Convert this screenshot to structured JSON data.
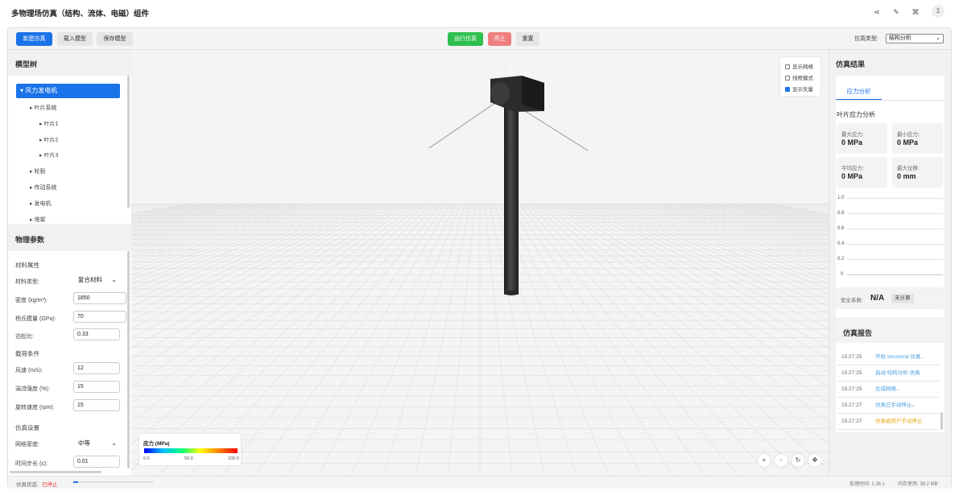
{
  "app": {
    "title": "多物理场仿真（结构、流体、电磁）组件"
  },
  "titlebar_icons": [
    {
      "name": "share-icon",
      "glyph": "⋖"
    },
    {
      "name": "edit-icon",
      "glyph": "✎"
    },
    {
      "name": "apps-icon",
      "glyph": "⌘"
    }
  ],
  "user": {
    "avatar_text": "1"
  },
  "toolbar": {
    "new_sim": "新建仿真",
    "load_model": "载入模型",
    "save_model": "保存模型",
    "run": "运行仿真",
    "stop": "停止",
    "reset": "重置",
    "sim_type_label": "仿真类型:",
    "sim_type_value": "结构分析"
  },
  "model_tree": {
    "title": "模型树",
    "root": "▾ 风力发电机",
    "items": [
      {
        "label": "▸ 叶片系统",
        "level": 1
      },
      {
        "label": "▸ 叶片1",
        "level": 2
      },
      {
        "label": "▸ 叶片2",
        "level": 2
      },
      {
        "label": "▸ 叶片3",
        "level": 2
      },
      {
        "label": "▸ 轮毂",
        "level": 1
      },
      {
        "label": "▸ 传动系统",
        "level": 1
      },
      {
        "label": "▸ 发电机",
        "level": 1
      },
      {
        "label": "▸ 塔架",
        "level": 1
      }
    ]
  },
  "params": {
    "title": "物理参数",
    "material_group": "材料属性",
    "material_type_label": "材料类型:",
    "material_type_value": "复合材料",
    "density_label": "密度 (kg/m³):",
    "density_value": "1850",
    "youngs_label": "杨氏模量 (GPa):",
    "youngs_value": "70",
    "poisson_label": "泊松比:",
    "poisson_value": "0.33",
    "load_group": "载荷条件",
    "wind_label": "风速 (m/s):",
    "wind_value": "12",
    "turb_label": "湍流强度 (%):",
    "turb_value": "15",
    "rot_label": "旋转速度 (rpm):",
    "rot_value": "15",
    "sim_group": "仿真设置",
    "mesh_label": "网格密度:",
    "mesh_value": "中等",
    "step_label": "时间步长 (s):",
    "step_value": "0.01"
  },
  "viewport": {
    "options": [
      {
        "label": "显示网格",
        "checked": false
      },
      {
        "label": "线框模式",
        "checked": false
      },
      {
        "label": "显示矢量",
        "checked": true
      }
    ],
    "legend": {
      "title": "应力 (MPa)",
      "min": "0.0",
      "mid": "50.0",
      "max": "100.0"
    },
    "controls": [
      {
        "name": "zoom-in-icon",
        "glyph": "+"
      },
      {
        "name": "zoom-out-icon",
        "glyph": "-"
      },
      {
        "name": "rotate-icon",
        "glyph": "↻"
      },
      {
        "name": "pan-icon",
        "glyph": "✥"
      }
    ]
  },
  "results": {
    "title": "仿真结果",
    "tab": "应力分析",
    "section": "叶片应力分析",
    "cards": [
      {
        "label": "最大应力:",
        "value": "0 MPa"
      },
      {
        "label": "最小应力:",
        "value": "0 MPa"
      },
      {
        "label": "平均应力:",
        "value": "0 MPa"
      },
      {
        "label": "最大位移:",
        "value": "0 mm"
      }
    ],
    "chart_ticks": [
      "1.0",
      "0.8",
      "0.6",
      "0.4",
      "0.2",
      "0"
    ],
    "safety_label": "安全系数:",
    "safety_value": "N/A",
    "safety_badge": "未计算"
  },
  "report": {
    "title": "仿真报告",
    "logs": [
      {
        "time": "15:27:25",
        "msg": "开始 structural 仿真...",
        "color": "#4a9fe0"
      },
      {
        "time": "15:27:25",
        "msg": "启动 结构分析 仿真",
        "color": "#4a9fe0"
      },
      {
        "time": "15:27:25",
        "msg": "生成网格...",
        "color": "#4a9fe0"
      },
      {
        "time": "15:27:27",
        "msg": "仿真已手动停止。",
        "color": "#4a9fe0"
      },
      {
        "time": "15:27:27",
        "msg": "仿真被用户手动停止",
        "color": "#e6a817"
      }
    ]
  },
  "status": {
    "label": "仿真状态:",
    "value": "已停止",
    "progress": 0.06,
    "proc_time": "处理时间: 1.36 s",
    "memory": "内存使用: 38.2 MB"
  },
  "colors": {
    "accent": "#1a73e8",
    "run": "#2fbf4f",
    "stop": "#ef7f7f",
    "status_stopped": "#e53935"
  }
}
